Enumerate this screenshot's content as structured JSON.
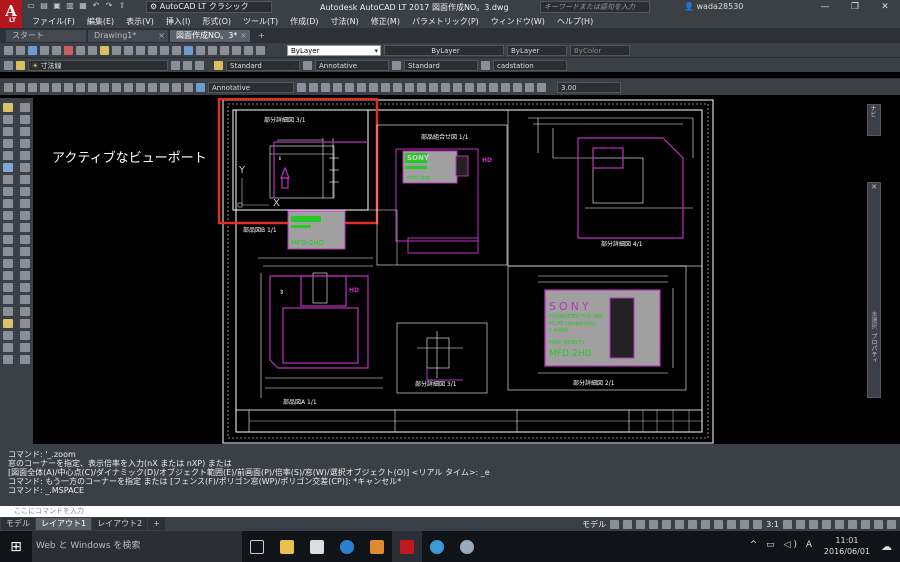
{
  "app": {
    "logo": "A",
    "logo_sub": "LT",
    "workspace": "AutoCAD LT クラシック",
    "window_title": "Autodesk AutoCAD LT 2017   図面作成NO。3.dwg",
    "search_placeholder": "キーワードまたは語句を入力",
    "user": "wada28530"
  },
  "menu": [
    "ファイル(F)",
    "編集(E)",
    "表示(V)",
    "挿入(I)",
    "形式(O)",
    "ツール(T)",
    "作成(D)",
    "寸法(N)",
    "修正(M)",
    "パラメトリック(P)",
    "ウィンドウ(W)",
    "ヘルプ(H)"
  ],
  "tabs": [
    {
      "label": "スタート",
      "active": false
    },
    {
      "label": "Drawing1*",
      "active": false,
      "close": "×"
    },
    {
      "label": "図面作成NO。3*",
      "active": true,
      "close": "×"
    },
    {
      "label": "+",
      "active": false
    }
  ],
  "toolbars": {
    "layer_color": "ByLayer",
    "linetype": "ByLayer",
    "lineweight": "ByLayer",
    "plotstyle": "ByColor",
    "layer_name": "寸法線",
    "text_style": "Standard",
    "dim_style": "Annotative",
    "table_style": "Standard",
    "mleader_style": "cadstation",
    "annoscale": "Annotative",
    "scale_value": "3.00"
  },
  "canvas": {
    "annotation": "アクティブなビューポート",
    "views": {
      "v1": "部分詳細図 3/1",
      "v2": "部品組合せ図 1/1",
      "v3": "部分詳細図 4/1",
      "v4": "部品図B 1/1",
      "v5": "部品図A 1/1",
      "v6": "部分詳細図 3/1",
      "v7": "部分詳細図 2/1"
    },
    "floppy": {
      "brand": "SONY",
      "line1": "FORMATTED FOR IBM",
      "line2": "PC/AT compatibles",
      "line3": "1.44MB",
      "line4": "HIGH DENSITY",
      "model": "MFD-2HD"
    },
    "ucs_y": "Y",
    "ucs_x": "X"
  },
  "right_panel": {
    "top_label": "ナビ",
    "properties_label": "プロパティ",
    "properties_sub": "未選択"
  },
  "command": {
    "lines": [
      "コマンド: '_.zoom",
      "窓のコーナーを指定、表示倍率を入力(nX または nXP) または",
      "[図面全体(A)/中心点(C)/ダイナミック(D)/オブジェクト範囲(E)/前画面(P)/倍率(S)/窓(W)/選択オブジェクト(O)] <リアル タイム>: _e",
      "コマンド: もう一方のコーナーを指定 または [フェンス(F)/ポリゴン窓(WP)/ポリゴン交差(CP)]: *キャンセル*",
      "コマンド: _.MSPACE"
    ],
    "placeholder": "ここにコマンドを入力"
  },
  "layout_tabs": [
    {
      "label": "モデル",
      "active": false
    },
    {
      "label": "レイアウト1",
      "active": true
    },
    {
      "label": "レイアウト2",
      "active": false
    },
    {
      "label": "+",
      "active": false
    }
  ],
  "status": {
    "space": "モデル",
    "scale": "3:1"
  },
  "taskbar": {
    "search": "Web と Windows を検索",
    "time": "11:01",
    "date": "2016/06/01",
    "ime": "A"
  }
}
